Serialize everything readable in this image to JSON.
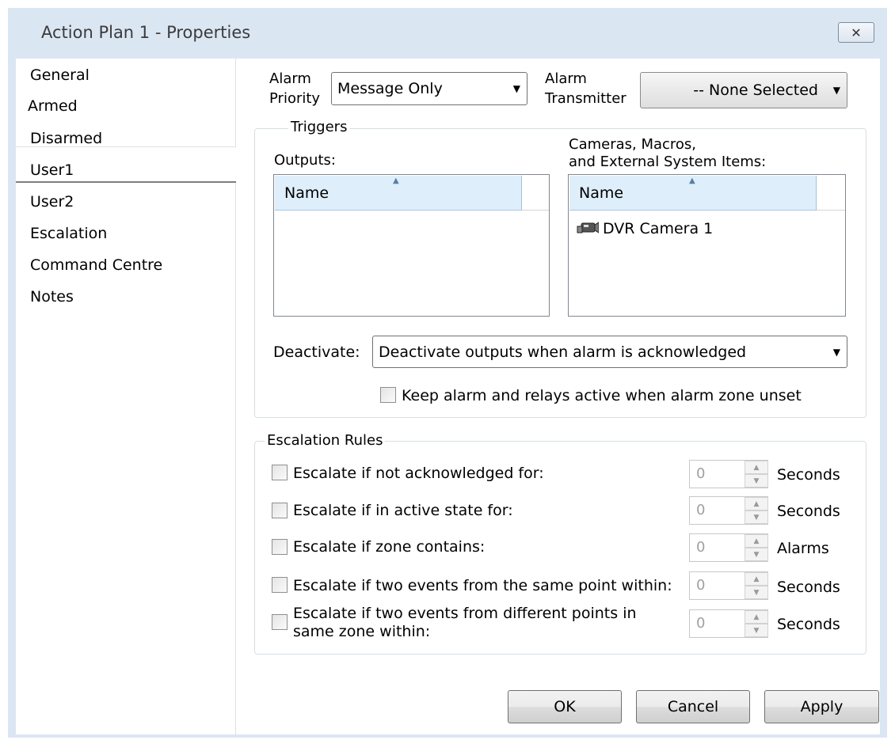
{
  "window": {
    "title": "Action Plan 1 - Properties",
    "close_glyph": "✕"
  },
  "nav": {
    "items": [
      {
        "label": "General"
      },
      {
        "label": "Armed"
      },
      {
        "label": "Disarmed"
      },
      {
        "label": "User1"
      },
      {
        "label": "User2"
      },
      {
        "label": "Escalation"
      },
      {
        "label": "Command Centre"
      },
      {
        "label": "Notes"
      }
    ],
    "selected": "Armed"
  },
  "alarm": {
    "priority_label_line1": "Alarm",
    "priority_label_line2": "Priority",
    "priority_value": "Message Only",
    "transmitter_label_line1": "Alarm",
    "transmitter_label_line2": "Transmitter",
    "transmitter_value": "-- None Selected"
  },
  "triggers": {
    "title": "Triggers",
    "outputs_label": "Outputs:",
    "outputs_header": "Name",
    "items_label_line1": "Cameras, Macros,",
    "items_label_line2": "and External System Items:",
    "items_header": "Name",
    "items": [
      {
        "label": "DVR Camera 1",
        "icon": "camera-icon"
      }
    ],
    "deactivate_label": "Deactivate:",
    "deactivate_value": "Deactivate outputs when alarm is acknowledged",
    "keep_active_label": "Keep alarm and relays active when alarm zone unset",
    "keep_active_checked": false
  },
  "escalation": {
    "title": "Escalation Rules",
    "rules": [
      {
        "label": "Escalate if not acknowledged for:",
        "value": "0",
        "unit": "Seconds",
        "checked": false
      },
      {
        "label": "Escalate if in active state for:",
        "value": "0",
        "unit": "Seconds",
        "checked": false
      },
      {
        "label": "Escalate if zone contains:",
        "value": "0",
        "unit": "Alarms",
        "checked": false
      },
      {
        "label": "Escalate if two events from the same point within:",
        "value": "0",
        "unit": "Seconds",
        "checked": false
      },
      {
        "label_line1": "Escalate if two events from different points in",
        "label_line2": "same zone within:",
        "value": "0",
        "unit": "Seconds",
        "checked": false
      }
    ]
  },
  "buttons": {
    "ok": "OK",
    "cancel": "Cancel",
    "apply": "Apply"
  }
}
